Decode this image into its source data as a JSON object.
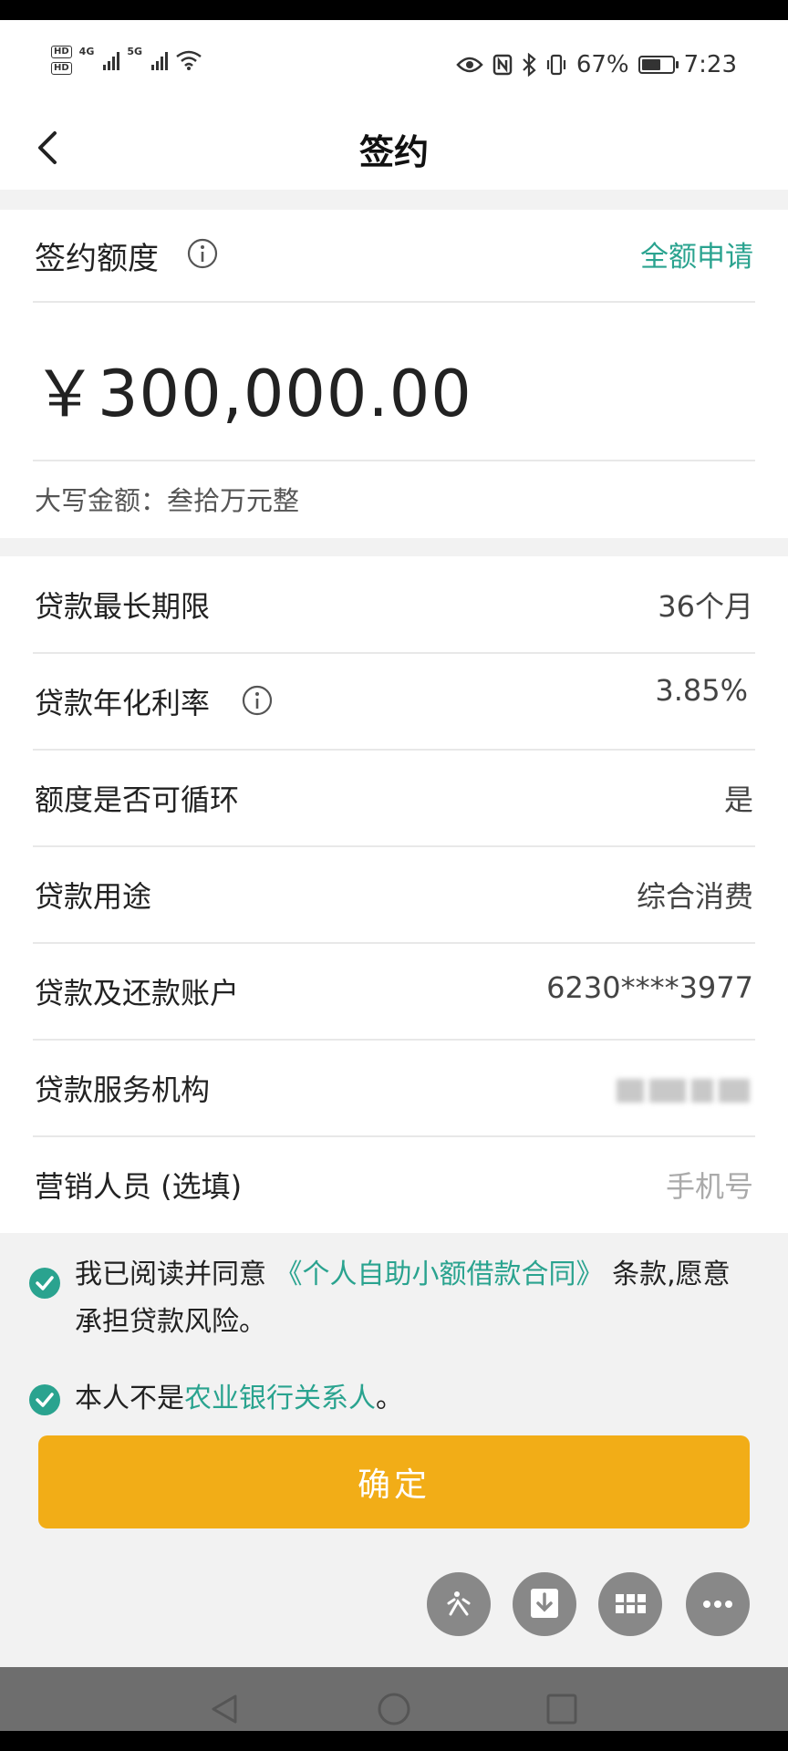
{
  "status_bar": {
    "hd_top": "HD",
    "hd_bottom": "HD",
    "net1": "4G",
    "net2": "5G",
    "battery": "67%",
    "battery_level": 0.67,
    "time": "7:23"
  },
  "header": {
    "title": "签约"
  },
  "limit": {
    "label": "签约额度",
    "full_apply": "全额申请",
    "amount": "￥300,000.00",
    "capital": "大写金额：叁拾万元整"
  },
  "details": [
    {
      "label": "贷款最长期限",
      "value": "36个月"
    },
    {
      "label": "贷款年化利率",
      "value": "3.85%"
    },
    {
      "label": "额度是否可循环",
      "value": "是"
    },
    {
      "label": "贷款用途",
      "value": "综合消费"
    },
    {
      "label": "贷款及还款账户",
      "value": "6230****3977"
    },
    {
      "label": "贷款服务机构",
      "value": ""
    },
    {
      "label": "营销人员 (选填)",
      "placeholder": "手机号"
    }
  ],
  "agreements": {
    "a1_pre": "我已阅读并同意 ",
    "a1_link": "《个人自助小额借款合同》",
    "a1_post": " 条款,愿意承担贷款风险。",
    "a2_pre": "本人不是",
    "a2_link": "农业银行关系人",
    "a2_post": "。"
  },
  "confirm_label": "确定",
  "colors": {
    "accent": "#2aa38f",
    "button": "#f2ad17"
  }
}
